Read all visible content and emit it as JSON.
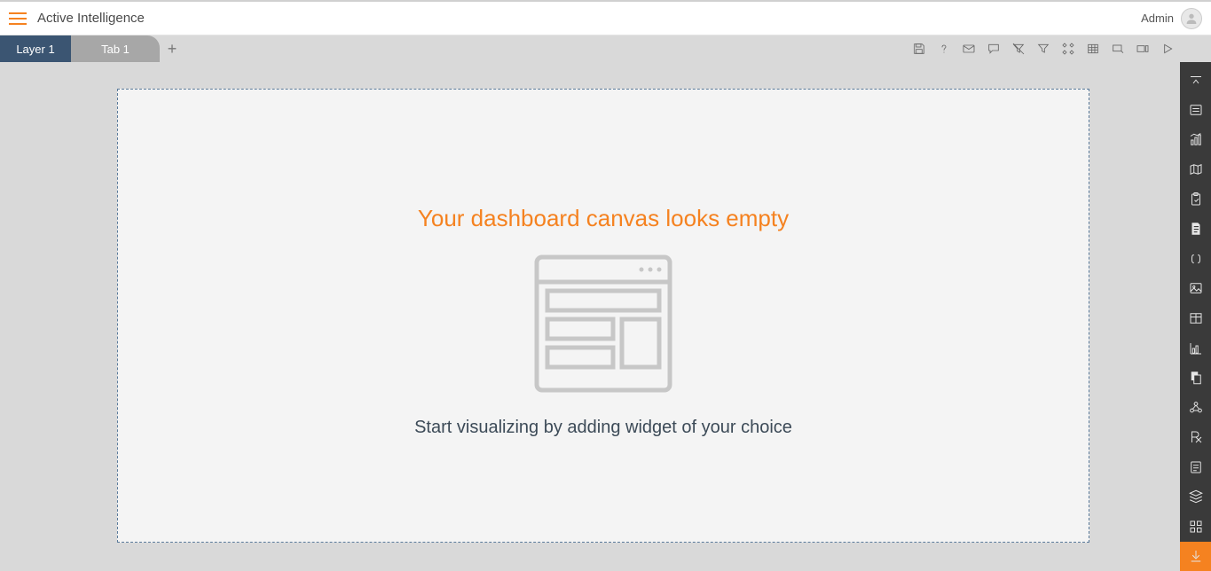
{
  "header": {
    "app_title": "Active Intelligence",
    "user_label": "Admin"
  },
  "tabs": {
    "layer_label": "Layer 1",
    "tab1_label": "Tab 1",
    "add_label": "+"
  },
  "toolbar": {
    "icons": [
      "save",
      "help",
      "mail",
      "comment",
      "clear-filter",
      "filter",
      "tools",
      "table",
      "zoom",
      "fit-screen",
      "play"
    ]
  },
  "canvas": {
    "empty_title": "Your dashboard canvas looks empty",
    "empty_subtitle": "Start visualizing by adding widget of your choice"
  },
  "sidepanel": {
    "items": [
      "collapse",
      "form",
      "chart",
      "map",
      "clipboard",
      "document",
      "code",
      "image",
      "table-widget",
      "bar-chart",
      "copy",
      "network",
      "prescription",
      "list",
      "layers",
      "grid",
      "download"
    ]
  }
}
